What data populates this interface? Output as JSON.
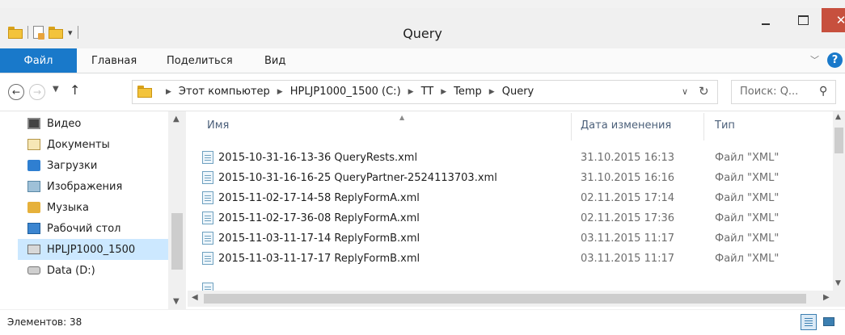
{
  "window": {
    "title": "Query",
    "close_glyph": "✕"
  },
  "ribbon": {
    "tabs": [
      "Файл",
      "Главная",
      "Поделиться",
      "Вид"
    ],
    "help_glyph": "?"
  },
  "address": {
    "crumbs": [
      "Этот компьютер",
      "HPLJP1000_1500 (C:)",
      "TT",
      "Temp",
      "Query"
    ],
    "separator": "▶"
  },
  "search": {
    "placeholder": "Поиск: Q..."
  },
  "nav_pane": {
    "items": [
      {
        "label": "Видео",
        "icon": "video-icon",
        "selected": false
      },
      {
        "label": "Документы",
        "icon": "documents-icon",
        "selected": false
      },
      {
        "label": "Загрузки",
        "icon": "downloads-icon",
        "selected": false
      },
      {
        "label": "Изображения",
        "icon": "pictures-icon",
        "selected": false
      },
      {
        "label": "Музыка",
        "icon": "music-icon",
        "selected": false
      },
      {
        "label": "Рабочий стол",
        "icon": "desktop-icon",
        "selected": false
      },
      {
        "label": "HPLJP1000_1500",
        "icon": "drive-icon",
        "selected": true
      },
      {
        "label": "Data (D:)",
        "icon": "data-drive-icon",
        "selected": false
      }
    ]
  },
  "file_list": {
    "columns": [
      "Имя",
      "Дата изменения",
      "Тип"
    ],
    "rows": [
      {
        "name": "2015-10-31-16-13-36 QueryRests.xml",
        "date": "31.10.2015 16:13",
        "type": "Файл \"XML\""
      },
      {
        "name": "2015-10-31-16-16-25 QueryPartner-2524113703.xml",
        "date": "31.10.2015 16:16",
        "type": "Файл \"XML\""
      },
      {
        "name": "2015-11-02-17-14-58 ReplyFormA.xml",
        "date": "02.11.2015 17:14",
        "type": "Файл \"XML\""
      },
      {
        "name": "2015-11-02-17-36-08 ReplyFormA.xml",
        "date": "02.11.2015 17:36",
        "type": "Файл \"XML\""
      },
      {
        "name": "2015-11-03-11-17-14 ReplyFormB.xml",
        "date": "03.11.2015 11:17",
        "type": "Файл \"XML\""
      },
      {
        "name": "2015-11-03-11-17-17 ReplyFormB.xml",
        "date": "03.11.2015 11:17",
        "type": "Файл \"XML\""
      }
    ]
  },
  "status": {
    "item_count": "Элементов: 38"
  },
  "colors": {
    "accent": "#1979ca",
    "close": "#c7503e",
    "selection": "#cce8ff"
  }
}
